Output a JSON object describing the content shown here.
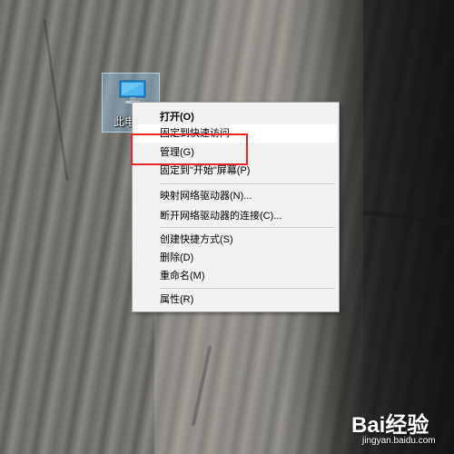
{
  "desktop_icon": {
    "label": "此电"
  },
  "context_menu": {
    "items": [
      {
        "label": "打开(O)",
        "bold": true
      },
      {
        "label": "固定到快速访问",
        "bold": false
      },
      {
        "label": "管理(G)",
        "bold": false
      },
      {
        "label": "固定到\"开始\"屏幕(P)",
        "bold": false
      },
      {
        "label": "映射网络驱动器(N)...",
        "bold": false
      },
      {
        "label": "断开网络驱动器的连接(C)...",
        "bold": false
      },
      {
        "label": "创建快捷方式(S)",
        "bold": false
      },
      {
        "label": "删除(D)",
        "bold": false
      },
      {
        "label": "重命名(M)",
        "bold": false
      },
      {
        "label": "属性(R)",
        "bold": false
      }
    ]
  },
  "highlight": {
    "target": "管理(G)",
    "color": "#e8262a"
  },
  "watermark": {
    "logo": "Bai经验",
    "url": "jingyan.baidu.com"
  }
}
